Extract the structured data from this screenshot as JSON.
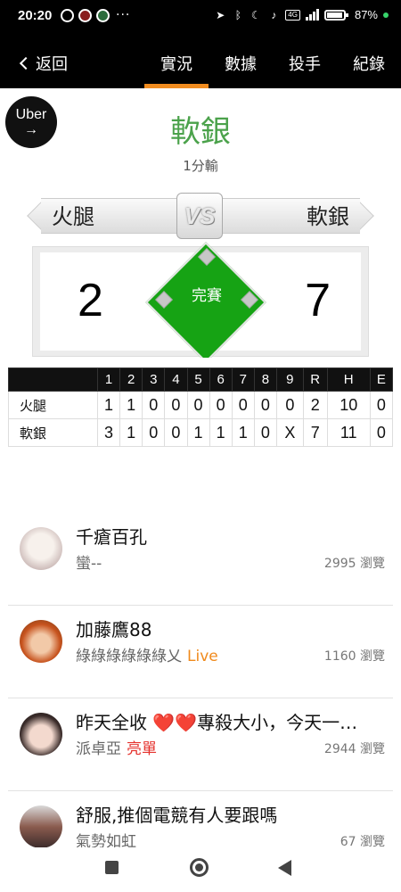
{
  "status": {
    "time": "20:20",
    "more": "···",
    "network": "4G",
    "battery": "87%"
  },
  "nav": {
    "back_label": "返回",
    "tabs": [
      {
        "label": "實況",
        "active": true
      },
      {
        "label": "數據",
        "active": false
      },
      {
        "label": "投手",
        "active": false
      },
      {
        "label": "紀錄",
        "active": false
      }
    ]
  },
  "sponsor": {
    "label": "Uber",
    "arrow": "→"
  },
  "game": {
    "winner": "軟銀",
    "result": "1分輸",
    "vs_badge": "VS",
    "away_team": "火腿",
    "home_team": "軟銀",
    "away_score": "2",
    "home_score": "7",
    "state": "完賽"
  },
  "linescore": {
    "headers": [
      "",
      "1",
      "2",
      "3",
      "4",
      "5",
      "6",
      "7",
      "8",
      "9",
      "R",
      "H",
      "E"
    ],
    "rows": [
      [
        "火腿",
        "1",
        "1",
        "0",
        "0",
        "0",
        "0",
        "0",
        "0",
        "0",
        "2",
        "10",
        "0"
      ],
      [
        "軟銀",
        "3",
        "1",
        "0",
        "0",
        "1",
        "1",
        "1",
        "0",
        "X",
        "7",
        "11",
        "0"
      ]
    ]
  },
  "feed": [
    {
      "title": "千瘡百孔",
      "author": "蠻--",
      "tag": "",
      "views": "2995 瀏覽"
    },
    {
      "title": "加藤鷹88",
      "author": "綠綠綠綠綠綠乂",
      "tag": "Live",
      "views": "1160 瀏覽"
    },
    {
      "title_before": "昨天全收 ",
      "hearts": "❤️❤️",
      "title_after": "專殺大小，今天一…",
      "author": "派卓亞",
      "tag": "亮單",
      "views": "2944 瀏覽"
    },
    {
      "title": "舒服,推個電競有人要跟嗎",
      "author": "氣勢如虹",
      "tag": "",
      "views": "67 瀏覽"
    }
  ],
  "colors": {
    "accent": "#f18c1f",
    "winner_green": "#4ba24b",
    "field_green": "#16a314",
    "live_orange": "#f08a1c",
    "pick_red": "#e5322d"
  }
}
